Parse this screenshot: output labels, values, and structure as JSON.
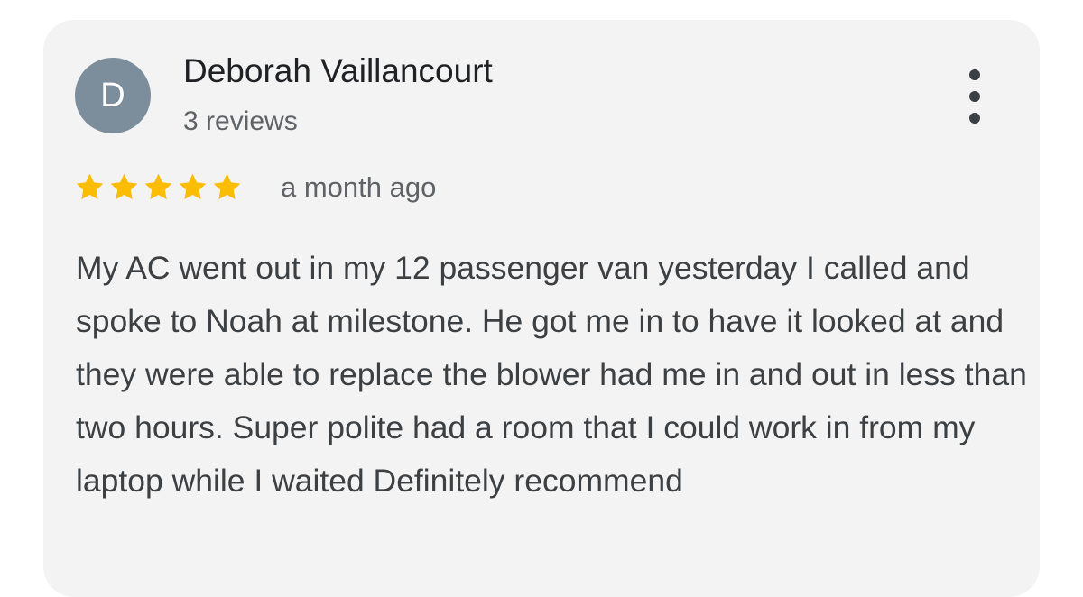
{
  "review": {
    "avatar_initial": "D",
    "reviewer_name": "Deborah Vaillancourt",
    "review_count": "3 reviews",
    "rating": 5,
    "rating_max": 5,
    "time_ago": "a month ago",
    "text": "My AC went out in my 12 passenger van yesterday I called and spoke to Noah at milestone. He got me in to have it looked at and they were able to replace the blower had me in and out in less than two hours. Super polite had a room that I could work in from my laptop while I waited Definitely recommend"
  },
  "menu": {
    "icon": "more-vertical-icon"
  },
  "colors": {
    "star": "#fbbc04",
    "avatar_bg": "#7c8d9c",
    "card_bg": "#f3f3f4"
  }
}
